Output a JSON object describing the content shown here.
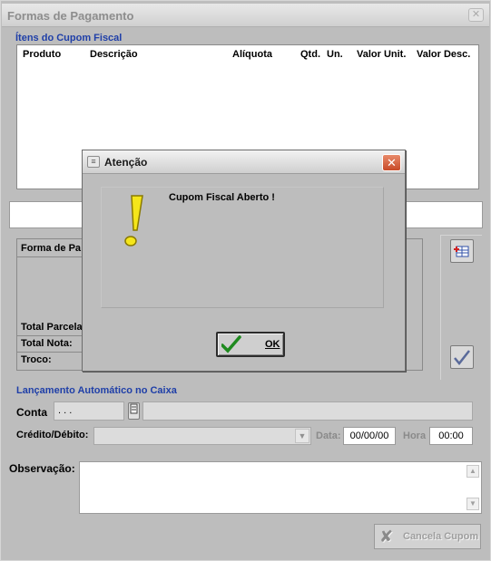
{
  "window": {
    "title": "Formas de Pagamento",
    "close_glyph": "✕"
  },
  "items": {
    "section_title": "Ítens do Cupom Fiscal",
    "columns": [
      "Produto",
      "Descrição",
      "Alíquota",
      "Qtd.",
      "Un.",
      "Valor Unit.",
      "Valor Desc."
    ]
  },
  "payments": {
    "header": "Forma de Pa",
    "total_parcelas_label": "Total Parcela",
    "total_nota_label": "Total Nota:",
    "troco_label": "Troco:"
  },
  "lancamento": {
    "section_title": "Lançamento Automático no Caixa",
    "conta_label": "Conta",
    "conta_value": ". . .",
    "credito_debito_label": "Crédito/Débito:",
    "data_label": "Data:",
    "data_value": "00/00/00",
    "hora_label": "Hora",
    "hora_value": "00:00"
  },
  "observacao": {
    "label": "Observação:"
  },
  "buttons": {
    "cancela_cupom": "Cancela Cupom"
  },
  "dialog": {
    "title": "Atenção",
    "message": "Cupom Fiscal Aberto !",
    "ok_label": "OK",
    "close_glyph": "✕",
    "icon": "exclamation-icon",
    "accent_color": "#f5e61a"
  },
  "icons": {
    "add_payment": "table-add-icon",
    "confirm": "checkmark-icon",
    "cancel": "x-icon",
    "ok": "green-checkmark-icon"
  }
}
